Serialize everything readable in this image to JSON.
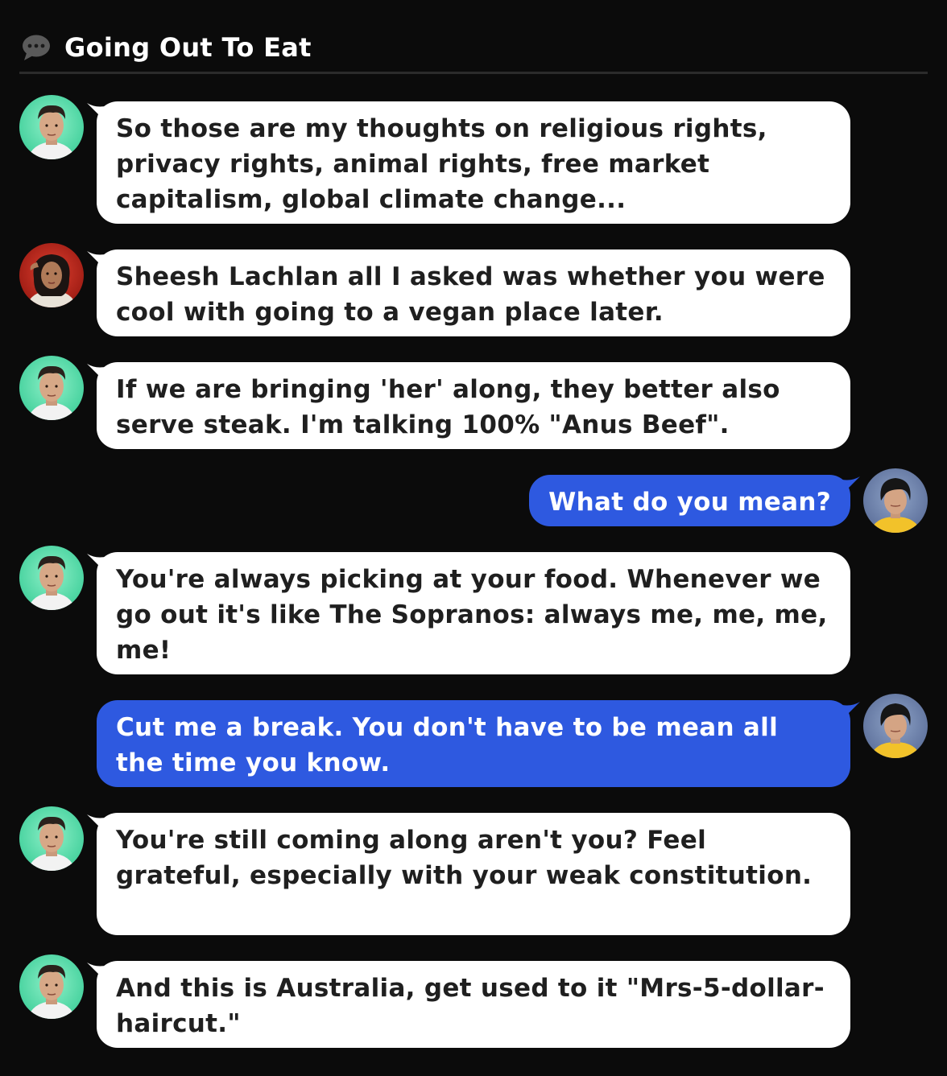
{
  "header": {
    "title": "Going Out To Eat",
    "icon": "chat-bubble-icon"
  },
  "colors": {
    "background": "#0b0b0b",
    "incoming_bubble": "#ffffff",
    "outgoing_bubble": "#2e59e0",
    "incoming_text": "#1f1f1f",
    "outgoing_text": "#ffffff"
  },
  "messages": [
    {
      "side": "left",
      "avatar": "green-man-avatar",
      "text": "So those are my thoughts on religious rights, privacy rights, animal rights, free market capitalism, global climate change..."
    },
    {
      "side": "left",
      "avatar": "red-woman-avatar",
      "text": "Sheesh Lachlan all I asked was whether you were cool with going to a vegan place later."
    },
    {
      "side": "left",
      "avatar": "green-man-avatar",
      "text": "If we are bringing 'her' along, they better also serve steak. I'm talking 100% \"Anus Beef\"."
    },
    {
      "side": "right",
      "avatar": "blue-woman-avatar",
      "text": "What do you mean?"
    },
    {
      "side": "left",
      "avatar": "green-man-avatar",
      "text": "You're always picking at your food. Whenever we go out it's like The Sopranos: always me, me, me, me!"
    },
    {
      "side": "right",
      "avatar": "blue-woman-avatar",
      "text": "Cut me a break. You don't have to be mean all the time you know."
    },
    {
      "side": "left",
      "avatar": "green-man-avatar",
      "text": "You're still coming along aren't you? Feel grateful, especially with your weak constitution."
    },
    {
      "side": "left",
      "avatar": "green-man-avatar",
      "text": "And this is Australia, get used to it \"Mrs-5-dollar-haircut.\""
    }
  ]
}
